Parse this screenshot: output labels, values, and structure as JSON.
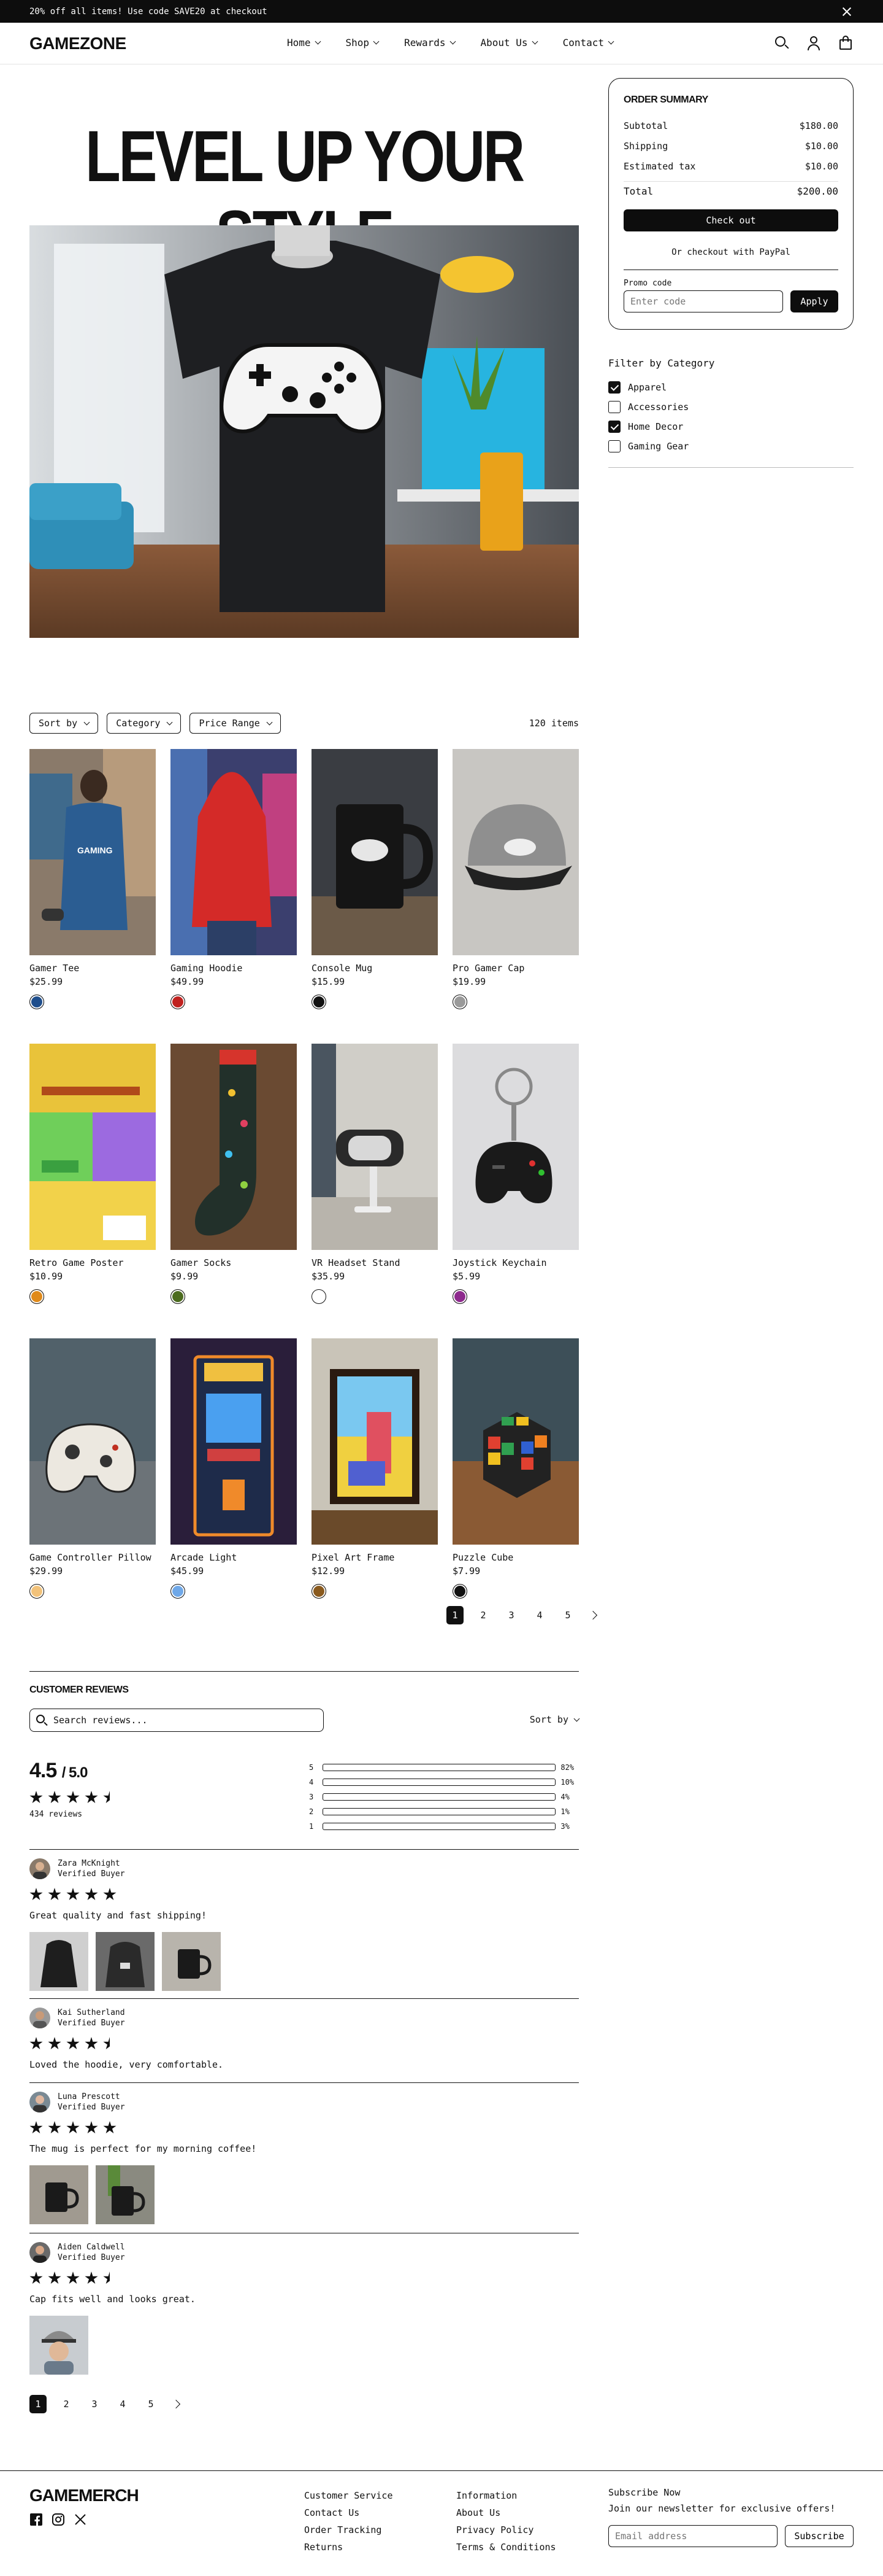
{
  "announcement": {
    "text": "20% off all items! Use code SAVE20 at checkout"
  },
  "nav": {
    "logo": "GAMEZONE",
    "menu": [
      "Home",
      "Shop",
      "Rewards",
      "About Us",
      "Contact"
    ]
  },
  "hero": {
    "title": "LEVEL UP YOUR STYLE"
  },
  "order_summary": {
    "title": "ORDER SUMMARY",
    "rows": [
      {
        "label": "Subtotal",
        "value": "$180.00"
      },
      {
        "label": "Shipping",
        "value": "$10.00"
      },
      {
        "label": "Estimated tax",
        "value": "$10.00"
      }
    ],
    "total_label": "Total",
    "total_value": "$200.00",
    "checkout_label": "Check out",
    "paypal_text": "Or checkout with PayPal",
    "promo_label": "Promo code",
    "promo_placeholder": "Enter code",
    "apply_label": "Apply"
  },
  "filter": {
    "title": "Filter by Category",
    "options": [
      {
        "label": "Apparel",
        "checked": true
      },
      {
        "label": "Accessories",
        "checked": false
      },
      {
        "label": "Home Decor",
        "checked": true
      },
      {
        "label": "Gaming Gear",
        "checked": false
      }
    ]
  },
  "toolbar": {
    "sort": "Sort by",
    "category": "Category",
    "price": "Price Range",
    "count": "120 items"
  },
  "products": [
    {
      "name": "Gamer Tee",
      "price": "$25.99",
      "swatch": "#1f4e8c"
    },
    {
      "name": "Gaming Hoodie",
      "price": "$49.99",
      "swatch": "#c0211f"
    },
    {
      "name": "Console Mug",
      "price": "$15.99",
      "swatch": "#111111"
    },
    {
      "name": "Pro Gamer Cap",
      "price": "$19.99",
      "swatch": "#9a9a9a"
    },
    {
      "name": "Retro Game Poster",
      "price": "$10.99",
      "swatch": "#e08a1a"
    },
    {
      "name": "Gamer Socks",
      "price": "$9.99",
      "swatch": "#4c6b1f"
    },
    {
      "name": "VR Headset Stand",
      "price": "$35.99",
      "swatch": "#ffffff"
    },
    {
      "name": "Joystick Keychain",
      "price": "$5.99",
      "swatch": "#8e2a8e"
    },
    {
      "name": "Game Controller Pillow",
      "price": "$29.99",
      "swatch": "#f2c27a"
    },
    {
      "name": "Arcade Light",
      "price": "$45.99",
      "swatch": "#6fa8e8"
    },
    {
      "name": "Pixel Art Frame",
      "price": "$12.99",
      "swatch": "#8a5a1e"
    },
    {
      "name": "Puzzle Cube",
      "price": "$7.99",
      "swatch": "#111111"
    }
  ],
  "product_pager": [
    "1",
    "2",
    "3",
    "4",
    "5"
  ],
  "reviews": {
    "title": "CUSTOMER REVIEWS",
    "search_placeholder": "Search reviews...",
    "sort_label": "Sort by",
    "average": "4.5",
    "average_max": "/ 5.0",
    "average_rating": 4.5,
    "count_text": "434 reviews",
    "distribution": [
      {
        "stars": "5",
        "pct": "82%",
        "value": 82
      },
      {
        "stars": "4",
        "pct": "10%",
        "value": 10
      },
      {
        "stars": "3",
        "pct": "4%",
        "value": 4
      },
      {
        "stars": "2",
        "pct": "1%",
        "value": 1
      },
      {
        "stars": "1",
        "pct": "3%",
        "value": 3
      }
    ],
    "items": [
      {
        "name": "Zara McKnight",
        "badge": "Verified Buyer",
        "rating": 5,
        "text": "Great quality and fast shipping!",
        "photos": [
          "hoodie-black",
          "hoodie-grey",
          "mug"
        ]
      },
      {
        "name": "Kai Sutherland",
        "badge": "Verified Buyer",
        "rating": 4.5,
        "text": "Loved the hoodie, very comfortable.",
        "photos": []
      },
      {
        "name": "Luna Prescott",
        "badge": "Verified Buyer",
        "rating": 5,
        "text": "The mug is perfect for my morning coffee!",
        "photos": [
          "mug",
          "mug"
        ]
      },
      {
        "name": "Aiden Caldwell",
        "badge": "Verified Buyer",
        "rating": 4.5,
        "text": "Cap fits well and looks great.",
        "photos": [
          "cap-person"
        ]
      }
    ],
    "pager": [
      "1",
      "2",
      "3",
      "4",
      "5"
    ]
  },
  "footer": {
    "logo": "GAMEMERCH",
    "social": [
      "facebook-icon",
      "instagram-icon",
      "x-icon"
    ],
    "col1": [
      "Customer Service",
      "Contact Us",
      "Order Tracking",
      "Returns"
    ],
    "col2": [
      "Information",
      "About Us",
      "Privacy Policy",
      "Terms & Conditions"
    ],
    "subscribe_title": "Subscribe Now",
    "subscribe_text": "Join our newsletter for exclusive offers!",
    "email_placeholder": "Email address",
    "subscribe_button": "Subscribe"
  }
}
